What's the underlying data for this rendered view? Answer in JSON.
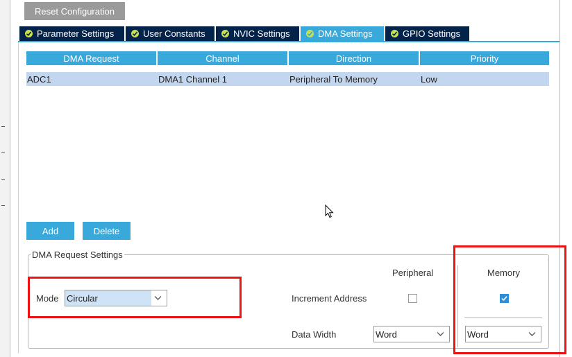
{
  "toolbar": {
    "reset_label": "Reset Configuration"
  },
  "tabs": [
    {
      "label": "Parameter Settings",
      "active": false
    },
    {
      "label": "User Constants",
      "active": false
    },
    {
      "label": "NVIC Settings",
      "active": false
    },
    {
      "label": "DMA Settings",
      "active": true
    },
    {
      "label": "GPIO Settings",
      "active": false
    }
  ],
  "table": {
    "headers": [
      "DMA Request",
      "Channel",
      "Direction",
      "Priority"
    ],
    "rows": [
      [
        "ADC1",
        "DMA1 Channel 1",
        "Peripheral To Memory",
        "Low"
      ]
    ]
  },
  "actions": {
    "add_label": "Add",
    "delete_label": "Delete"
  },
  "request_settings": {
    "title": "DMA Request Settings",
    "mode_label": "Mode",
    "mode_value": "Circular",
    "peripheral_header": "Peripheral",
    "memory_header": "Memory",
    "increment_label": "Increment Address",
    "peripheral_increment": false,
    "memory_increment": true,
    "data_width_label": "Data Width",
    "peripheral_width": "Word",
    "memory_width": "Word"
  },
  "colors": {
    "tab_bg": "#03234b",
    "tab_active": "#39a9dc",
    "header_bg": "#39a9dc",
    "row_selected": "#c2d6ef",
    "highlight_box": "#ee1111"
  },
  "icons": [
    "check-circle-icon",
    "chevron-down-icon",
    "checkbox-checked-icon",
    "mouse-cursor-icon"
  ]
}
